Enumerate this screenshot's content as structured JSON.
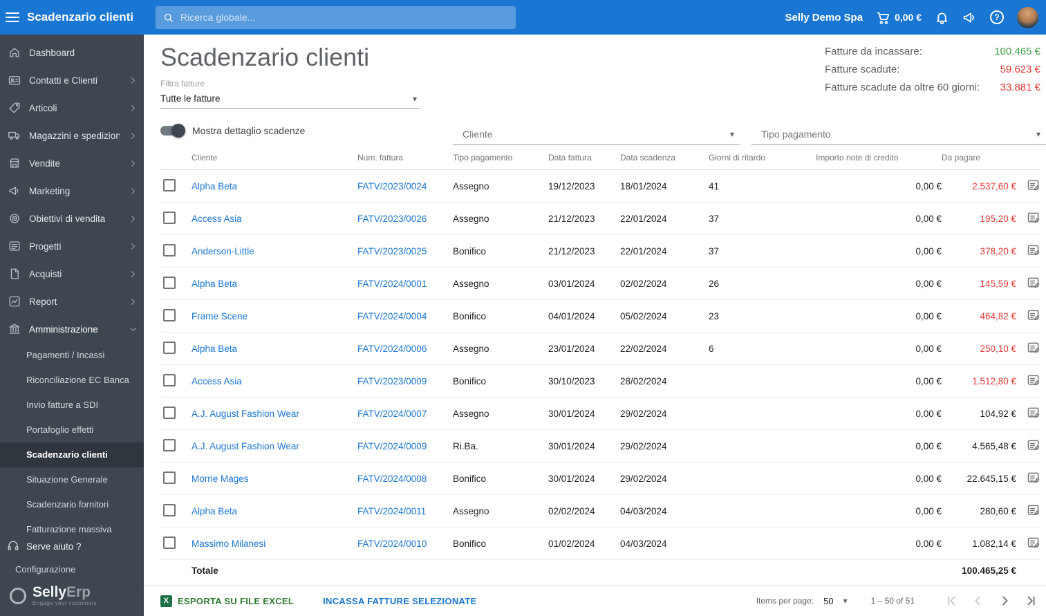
{
  "icons": {
    "help_glyph": "?",
    "caret": "▾",
    "excel_glyph": "X"
  },
  "topbar": {
    "title": "Scadenzario clienti",
    "search_placeholder": "Ricerca globale...",
    "company": "Selly Demo Spa",
    "cart_amount": "0,00 €"
  },
  "sidebar": {
    "items": [
      {
        "label": "Dashboard",
        "icon": "home",
        "chevron": false
      },
      {
        "label": "Contatti e Clienti",
        "icon": "contacts",
        "chevron": "right"
      },
      {
        "label": "Articoli",
        "icon": "tag",
        "chevron": "right"
      },
      {
        "label": "Magazzini e spedizion",
        "icon": "truck",
        "chevron": "right"
      },
      {
        "label": "Vendite",
        "icon": "store",
        "chevron": "right"
      },
      {
        "label": "Marketing",
        "icon": "megaphone",
        "chevron": "right"
      },
      {
        "label": "Obiettivi di vendita",
        "icon": "target",
        "chevron": "right"
      },
      {
        "label": "Progetti",
        "icon": "list",
        "chevron": "right"
      },
      {
        "label": "Acquisti",
        "icon": "document",
        "chevron": "right"
      },
      {
        "label": "Report",
        "icon": "chart",
        "chevron": "right"
      },
      {
        "label": "Amministrazione",
        "icon": "bank",
        "chevron": "down",
        "expanded": true
      }
    ],
    "admin_subitems": [
      "Pagamenti / Incassi",
      "Riconciliazione EC Banca",
      "Invio fatture a SDI",
      "Portafoglio effetti",
      "Scadenzario clienti",
      "Situazione Generale",
      "Scadenzario fornitori",
      "Fatturazione massiva"
    ],
    "active_subitem": "Scadenzario clienti",
    "help_label": "Serve aiuto ?",
    "config_label": "Configurazione",
    "logo_primary": "Selly",
    "logo_secondary": "Erp",
    "logo_tagline": "Engage your customers"
  },
  "main": {
    "title": "Scadenzario clienti",
    "filter_label": "Filtra fatture",
    "filter_value": "Tutte le fatture",
    "toggle_label": "Mostra dettaglio scadenze",
    "cliente_placeholder": "Cliente",
    "tipo_pagamento_placeholder": "Tipo pagamento",
    "summary": [
      {
        "label": "Fatture da incassare:",
        "value": "100.465 €",
        "color": "green"
      },
      {
        "label": "Fatture scadute:",
        "value": "59.623 €",
        "color": "red"
      },
      {
        "label": "Fatture scadute da oltre 60 giorni:",
        "value": "33.881 €",
        "color": "red"
      }
    ]
  },
  "table": {
    "columns": [
      "Cliente",
      "Num. fattura",
      "Tipo pagamento",
      "Data fattura",
      "Data scadenza",
      "Giorni di ritardo",
      "Importo note di credito",
      "Da pagare"
    ],
    "rows": [
      {
        "cliente": "Alpha Beta",
        "num": "FATV/2023/0024",
        "tipo": "Assegno",
        "data_fattura": "19/12/2023",
        "data_scadenza": "18/01/2024",
        "giorni": "41",
        "nota_credito": "0,00 €",
        "da_pagare": "2.537,60 €",
        "overdue": true
      },
      {
        "cliente": "Access Asia",
        "num": "FATV/2023/0026",
        "tipo": "Assegno",
        "data_fattura": "21/12/2023",
        "data_scadenza": "22/01/2024",
        "giorni": "37",
        "nota_credito": "0,00 €",
        "da_pagare": "195,20 €",
        "overdue": true
      },
      {
        "cliente": "Anderson-Little",
        "num": "FATV/2023/0025",
        "tipo": "Bonifico",
        "data_fattura": "21/12/2023",
        "data_scadenza": "22/01/2024",
        "giorni": "37",
        "nota_credito": "0,00 €",
        "da_pagare": "378,20 €",
        "overdue": true
      },
      {
        "cliente": "Alpha Beta",
        "num": "FATV/2024/0001",
        "tipo": "Assegno",
        "data_fattura": "03/01/2024",
        "data_scadenza": "02/02/2024",
        "giorni": "26",
        "nota_credito": "0,00 €",
        "da_pagare": "145,59 €",
        "overdue": true
      },
      {
        "cliente": "Frame Scene",
        "num": "FATV/2024/0004",
        "tipo": "Bonifico",
        "data_fattura": "04/01/2024",
        "data_scadenza": "05/02/2024",
        "giorni": "23",
        "nota_credito": "0,00 €",
        "da_pagare": "464,82 €",
        "overdue": true
      },
      {
        "cliente": "Alpha Beta",
        "num": "FATV/2024/0006",
        "tipo": "Assegno",
        "data_fattura": "23/01/2024",
        "data_scadenza": "22/02/2024",
        "giorni": "6",
        "nota_credito": "0,00 €",
        "da_pagare": "250,10 €",
        "overdue": true
      },
      {
        "cliente": "Access Asia",
        "num": "FATV/2023/0009",
        "tipo": "Bonifico",
        "data_fattura": "30/10/2023",
        "data_scadenza": "28/02/2024",
        "giorni": "",
        "nota_credito": "0,00 €",
        "da_pagare": "1.512,80 €",
        "overdue": true
      },
      {
        "cliente": "A.J. August Fashion Wear",
        "num": "FATV/2024/0007",
        "tipo": "Assegno",
        "data_fattura": "30/01/2024",
        "data_scadenza": "29/02/2024",
        "giorni": "",
        "nota_credito": "0,00 €",
        "da_pagare": "104,92 €",
        "overdue": false
      },
      {
        "cliente": "A.J. August Fashion Wear",
        "num": "FATV/2024/0009",
        "tipo": "Ri.Ba.",
        "data_fattura": "30/01/2024",
        "data_scadenza": "29/02/2024",
        "giorni": "",
        "nota_credito": "0,00 €",
        "da_pagare": "4.565,48 €",
        "overdue": false
      },
      {
        "cliente": "Morrie Mages",
        "num": "FATV/2024/0008",
        "tipo": "Bonifico",
        "data_fattura": "30/01/2024",
        "data_scadenza": "29/02/2024",
        "giorni": "",
        "nota_credito": "0,00 €",
        "da_pagare": "22.645,15 €",
        "overdue": false
      },
      {
        "cliente": "Alpha Beta",
        "num": "FATV/2024/0011",
        "tipo": "Assegno",
        "data_fattura": "02/02/2024",
        "data_scadenza": "04/03/2024",
        "giorni": "",
        "nota_credito": "0,00 €",
        "da_pagare": "280,60 €",
        "overdue": false
      },
      {
        "cliente": "Massimo Milanesi",
        "num": "FATV/2024/0010",
        "tipo": "Bonifico",
        "data_fattura": "01/02/2024",
        "data_scadenza": "04/03/2024",
        "giorni": "",
        "nota_credito": "0,00 €",
        "da_pagare": "1.082,14 €",
        "overdue": false
      }
    ],
    "total_label": "Totale",
    "total_value": "100.465,25 €"
  },
  "footer": {
    "export_label": "ESPORTA SU FILE EXCEL",
    "collect_label": "INCASSA FATTURE SELEZIONATE",
    "items_per_page_label": "Items per page:",
    "items_per_page_value": "50",
    "range": "1 – 50 of 51"
  }
}
